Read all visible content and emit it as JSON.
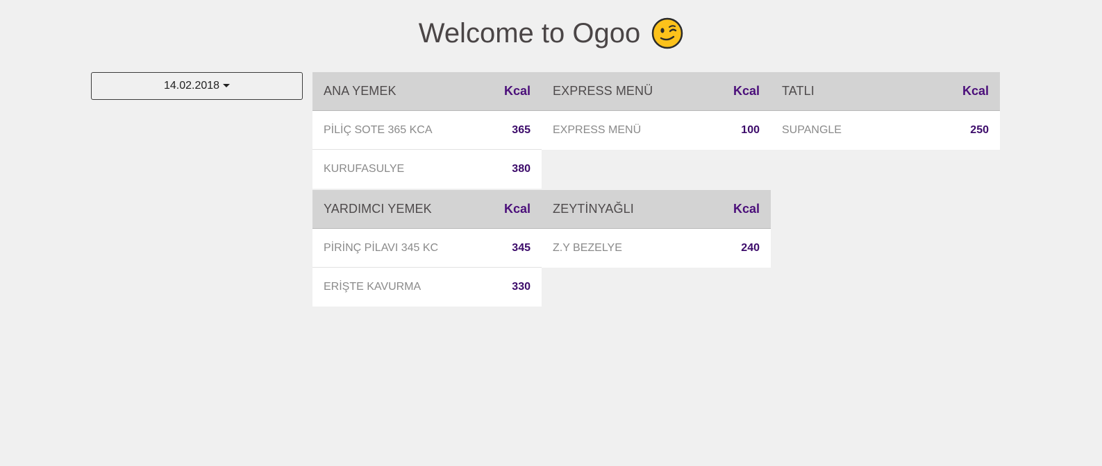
{
  "page": {
    "title": "Welcome to Ogoo",
    "emoji_icon": "winking-face-icon"
  },
  "date_selector": {
    "value": "14.02.2018"
  },
  "menus": {
    "ana_yemek": {
      "category": "ANA YEMEK",
      "kcal_label": "Kcal",
      "items": [
        {
          "name": "PİLİÇ SOTE 365 KCA",
          "kcal": "365"
        },
        {
          "name": "KURUFASULYE",
          "kcal": "380"
        }
      ]
    },
    "express_menu": {
      "category": "EXPRESS MENÜ",
      "kcal_label": "Kcal",
      "items": [
        {
          "name": "EXPRESS MENÜ",
          "kcal": "100"
        }
      ]
    },
    "tatli": {
      "category": "TATLI",
      "kcal_label": "Kcal",
      "items": [
        {
          "name": "SUPANGLE",
          "kcal": "250"
        }
      ]
    },
    "yardimci_yemek": {
      "category": "YARDIMCI YEMEK",
      "kcal_label": "Kcal",
      "items": [
        {
          "name": "PİRİNÇ PİLAVI 345 KC",
          "kcal": "345"
        },
        {
          "name": "ERİŞTE KAVURMA",
          "kcal": "330"
        }
      ]
    },
    "zeytinyagli": {
      "category": "ZEYTİNYAĞLI",
      "kcal_label": "Kcal",
      "items": [
        {
          "name": "Z.Y BEZELYE",
          "kcal": "240"
        }
      ]
    }
  },
  "colors": {
    "background": "#f0f0f0",
    "header_bg": "#d3d3d3",
    "kcal_purple": "#4b0f7a",
    "item_text": "#8a8a8a"
  }
}
